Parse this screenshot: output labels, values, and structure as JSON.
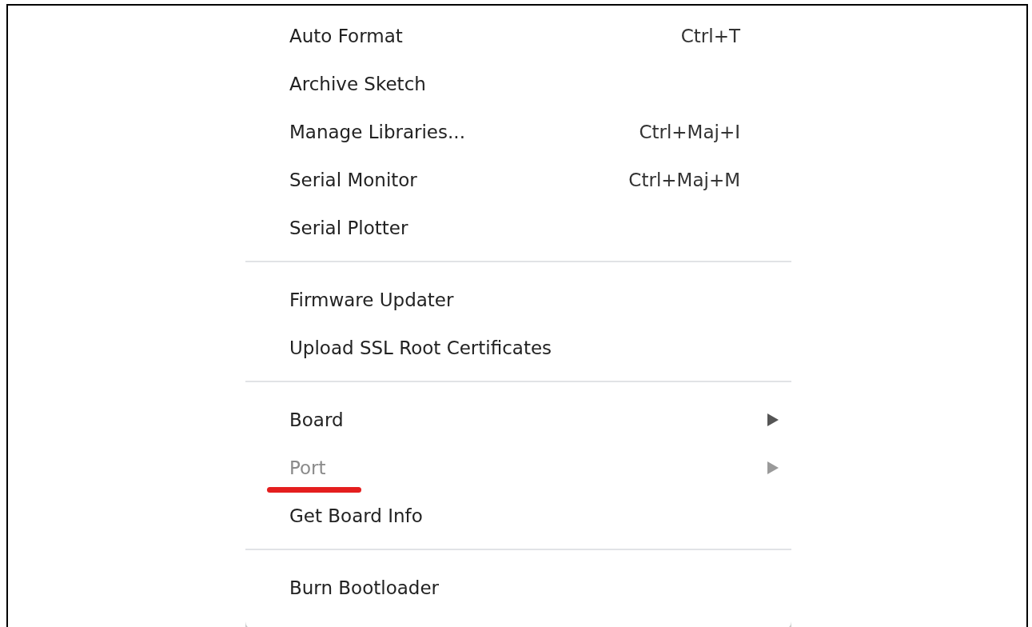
{
  "menu": {
    "groups": [
      {
        "items": [
          {
            "label": "Auto Format",
            "shortcut": "Ctrl+T",
            "submenu": false,
            "disabled": false,
            "underlined": false
          },
          {
            "label": "Archive Sketch",
            "submenu": false,
            "disabled": false,
            "underlined": false
          },
          {
            "label": "Manage Libraries...",
            "shortcut": "Ctrl+Maj+I",
            "submenu": false,
            "disabled": false,
            "underlined": false
          },
          {
            "label": "Serial Monitor",
            "shortcut": "Ctrl+Maj+M",
            "submenu": false,
            "disabled": false,
            "underlined": false
          },
          {
            "label": "Serial Plotter",
            "submenu": false,
            "disabled": false,
            "underlined": false
          }
        ]
      },
      {
        "items": [
          {
            "label": "Firmware Updater",
            "submenu": false,
            "disabled": false,
            "underlined": false
          },
          {
            "label": "Upload SSL Root Certificates",
            "submenu": false,
            "disabled": false,
            "underlined": false
          }
        ]
      },
      {
        "items": [
          {
            "label": "Board",
            "submenu": true,
            "disabled": false,
            "underlined": false
          },
          {
            "label": "Port",
            "submenu": true,
            "disabled": true,
            "underlined": true
          },
          {
            "label": "Get Board Info",
            "submenu": false,
            "disabled": false,
            "underlined": false
          }
        ]
      },
      {
        "items": [
          {
            "label": "Burn Bootloader",
            "submenu": false,
            "disabled": false,
            "underlined": false
          }
        ]
      }
    ]
  }
}
